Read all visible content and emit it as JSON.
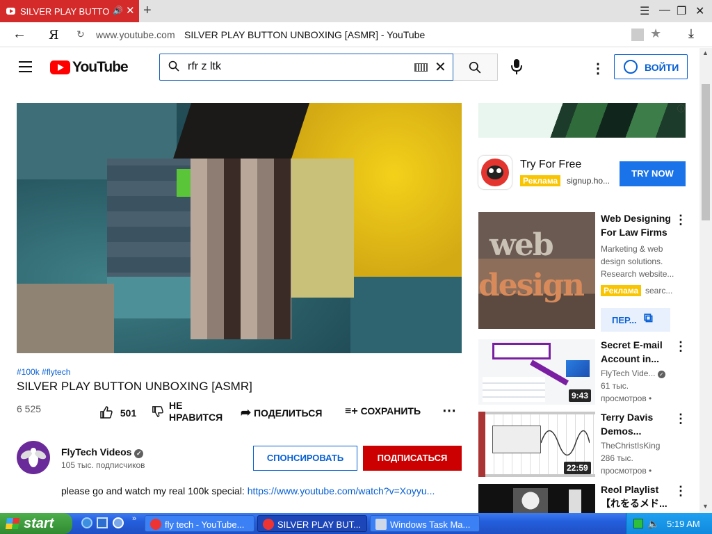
{
  "browser": {
    "tab_title": "SILVER PLAY BUTTON",
    "url_host": "www.youtube.com",
    "page_title": "SILVER PLAY BUTTON UNBOXING [ASMR] - YouTube",
    "yandex_letter": "Я"
  },
  "header": {
    "logo_text": "YouTube",
    "search_value": "rfr z ltk",
    "signin_label": "ВОЙТИ"
  },
  "video": {
    "tags": "#100k #flytech",
    "title": "SILVER PLAY BUTTON UNBOXING [ASMR]",
    "views": "6 525",
    "likes": "501",
    "dislike_label_1": "НЕ",
    "dislike_label_2": "НРАВИТСЯ",
    "share_label": "ПОДЕЛИТЬСЯ",
    "save_label": "СОХРАНИТЬ",
    "channel_name": "FlyTech Videos",
    "subscribers": "105 тыс. подписчиков",
    "sponsor_label": "СПОНСИРОВАТЬ",
    "subscribe_label": "ПОДПИСАТЬСЯ",
    "description_text": "please go and watch my real 100k special: ",
    "description_link": "https://www.youtube.com/watch?v=Xoyyu..."
  },
  "sidebar": {
    "ad_top": {
      "title": "Try For Free",
      "badge": "Реклама",
      "domain": "signup.ho...",
      "cta": "TRY NOW"
    },
    "items": [
      {
        "title_1": "Web Designing",
        "title_2": "For Law Firms",
        "meta_1": "Marketing & web",
        "meta_2": "design solutions.",
        "meta_3": "Research website...",
        "badge": "Реклама",
        "domain": "searc...",
        "cta": "ПЕР..."
      },
      {
        "title_1": "Secret E-mail",
        "title_2": "Account in...",
        "channel": "FlyTech Vide...",
        "meta_2": "61 тыс.",
        "meta_3": "просмотров •",
        "duration": "9:43"
      },
      {
        "title_1": "Terry Davis",
        "title_2": "Demos...",
        "channel": "TheChristIsKing",
        "meta_2": "286 тыс.",
        "meta_3": "просмотров •",
        "duration": "22:59"
      },
      {
        "title_1": "Reol Playlist",
        "title_2": "【れをるメド..."
      }
    ]
  },
  "taskbar": {
    "start_label": "start",
    "tasks": [
      "fly tech - YouTube...",
      "SILVER PLAY BUT...",
      "Windows Task Ma..."
    ],
    "clock": "5:19 AM"
  },
  "colors": {
    "youtube_red": "#ff0000",
    "link_blue": "#065fd4",
    "ad_yellow": "#f9c400"
  }
}
